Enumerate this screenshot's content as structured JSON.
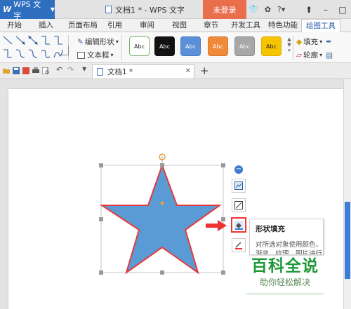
{
  "title_bar": {
    "app_menu": "WPS 文字",
    "document_title": "文档1 * - WPS 文字",
    "login_button": "未登录",
    "help_button": "?"
  },
  "tabs": [
    "开始",
    "插入",
    "页面布局",
    "引用",
    "审阅",
    "视图",
    "章节",
    "开发工具",
    "特色功能",
    "绘图工具"
  ],
  "active_tab": "绘图工具",
  "ribbon": {
    "edit_shape": "编辑形状",
    "text_box": "文本框",
    "style_presets": [
      {
        "label": "Abc",
        "bg": "#ffffff",
        "border": "#7bb26a",
        "color": "#222222"
      },
      {
        "label": "Abc",
        "bg": "#111111",
        "border": "#111111",
        "color": "#ffffff"
      },
      {
        "label": "Abc",
        "bg": "#5b8fd8",
        "border": "#4a7bc0",
        "color": "#ffffff"
      },
      {
        "label": "Abc",
        "bg": "#ef8a3a",
        "border": "#d9762a",
        "color": "#ffffff"
      },
      {
        "label": "Abc",
        "bg": "#a7a7a7",
        "border": "#8f8f8f",
        "color": "#ffffff"
      },
      {
        "label": "Abc",
        "bg": "#f7c400",
        "border": "#ddae00",
        "color": "#222222"
      }
    ],
    "fill": "填充",
    "outline": "轮廓"
  },
  "document_tab": {
    "label": "文档1 *"
  },
  "canvas": {
    "star_fill": "#5b9bd5",
    "star_outline": "#e23b3b",
    "selection_handle_color": "#9a9a9a"
  },
  "tooltip": {
    "title": "形状填充",
    "description": "对所选对象使用颜色、",
    "description_partial": "渐变、纹理、图片进行"
  },
  "watermark": {
    "title": "百科全说",
    "subtitle": "助你轻松解决"
  }
}
